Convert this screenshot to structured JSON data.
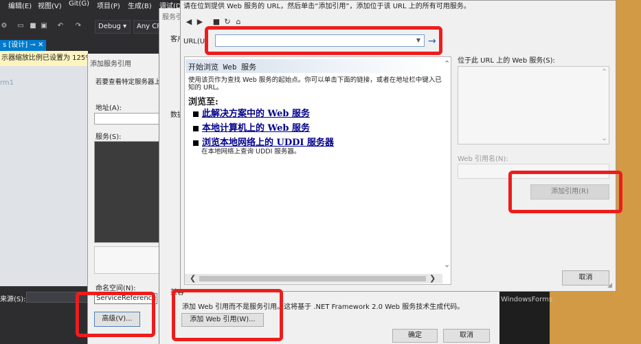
{
  "vs": {
    "menu": [
      "编辑(E)",
      "视图(V)",
      "Git(G)",
      "项目(P)",
      "生成(B)",
      "调试(D"
    ],
    "config": "Debug",
    "platform": "Any CP",
    "tab": "s [设计]",
    "infobar": "示器缩放比例已设置为 125%。",
    "form_label": "rm1",
    "bottom_label": "来源(S):",
    "right_text": "WindowsForms"
  },
  "svc_dialog": {
    "title": "添加服务引用",
    "hint": "若要查看特定服务器上现”。",
    "address_label": "地址(A):",
    "services_label": "服务(S):",
    "namespace_label": "命名空间(N):",
    "namespace_value": "ServiceReference1",
    "advanced_button": "高级(V)..."
  },
  "mid_dialog": {
    "title": "服务引",
    "client_label": "客户",
    "data_label": "数据",
    "comment_label": "兼容",
    "note": "添加 Web 引用而不是服务引用。这将基于 .NET Framework 2.0 Web 服务技术生成代码。",
    "add_web_ref_button": "添加 Web 引用(W)...",
    "ok_button": "确定",
    "cancel_button": "取消"
  },
  "web_dialog": {
    "instruction": "请在位到提供 Web 服务的 URL，然后单击“添加引用”，添加位于该 URL 上的所有可用服务。",
    "url_label": "URL(U)",
    "url_value": "",
    "browser": {
      "heading": "开始浏览 Web 服务",
      "intro": "使用该页作为查找 Web 服务的起始点。你可以单击下面的链接，或者在地址栏中键入已知的 URL。",
      "browse_to": "浏览至:",
      "links": [
        "此解决方案中的 Web 服务",
        "本地计算机上的 Web 服务",
        "浏览本地网络上的 UDDI 服务器"
      ],
      "sub_text": "在本地网络上查询 UDDI 服务器。"
    },
    "services_label": "位于此 URL 上的 Web 服务(S):",
    "web_ref_name_label": "Web 引用名(N):",
    "add_reference_button": "添加引用(R)",
    "cancel_button": "取消"
  },
  "colors": {
    "highlight": "#ee1c1c",
    "vs_dark": "#2d2d30",
    "accent": "#007acc",
    "link": "#00008b",
    "orange_bg": "#d39a45"
  }
}
